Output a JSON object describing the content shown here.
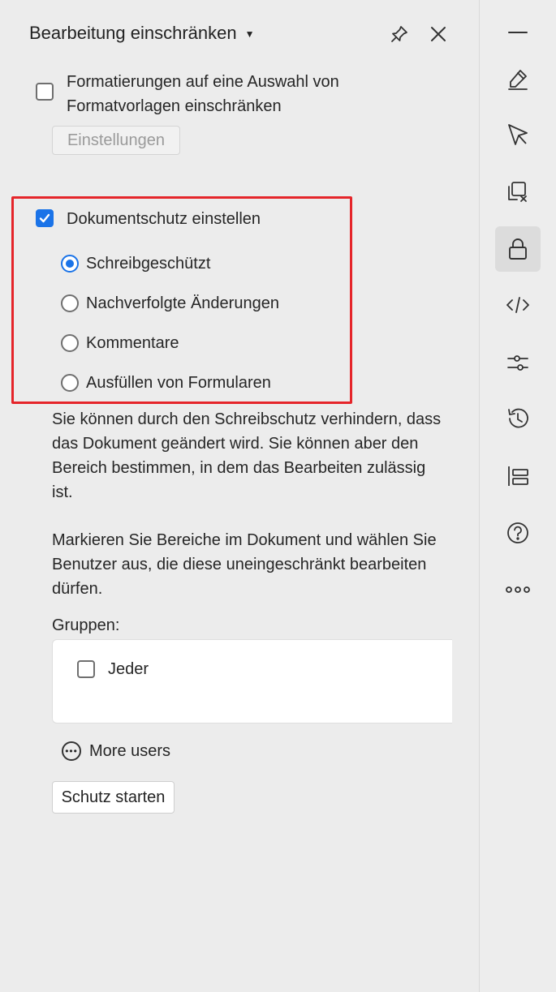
{
  "panel": {
    "title": "Bearbeitung einschränken",
    "format_restrict_label_line1": "Formatierungen auf eine Auswahl von",
    "format_restrict_label_line2": "Formatvorlagen einschränken",
    "format_restrict_checked": false,
    "settings_button": "Einstellungen",
    "protection_label": "Dokumentschutz einstellen",
    "protection_checked": true,
    "options": [
      {
        "label": "Schreibgeschützt",
        "selected": true
      },
      {
        "label": "Nachverfolgte Änderungen",
        "selected": false
      },
      {
        "label": "Kommentare",
        "selected": false
      },
      {
        "label": "Ausfüllen von Formularen",
        "selected": false
      }
    ],
    "description1": [
      "Sie können durch den Schreibschutz verhindern, dass",
      "das Dokument geändert wird. Sie können aber den",
      "Bereich bestimmen, in dem das Bearbeiten zulässig",
      "ist."
    ],
    "description2": [
      "Markieren Sie Bereiche im Dokument und wählen Sie",
      "Benutzer aus, die diese uneingeschränkt bearbeiten",
      "dürfen."
    ],
    "groups_label": "Gruppen:",
    "group_everyone": "Jeder",
    "group_everyone_checked": false,
    "more_users": "More users",
    "start_button": "Schutz starten"
  },
  "rail": {
    "icons": [
      "minimize-icon",
      "pen-icon",
      "pointer-icon",
      "clear-format-icon",
      "lock-icon",
      "code-icon",
      "sliders-icon",
      "history-icon",
      "structure-icon",
      "help-icon",
      "more-icon"
    ],
    "active": "lock-icon"
  },
  "colors": {
    "accent": "#1a73e8",
    "highlight": "#e5252a"
  }
}
